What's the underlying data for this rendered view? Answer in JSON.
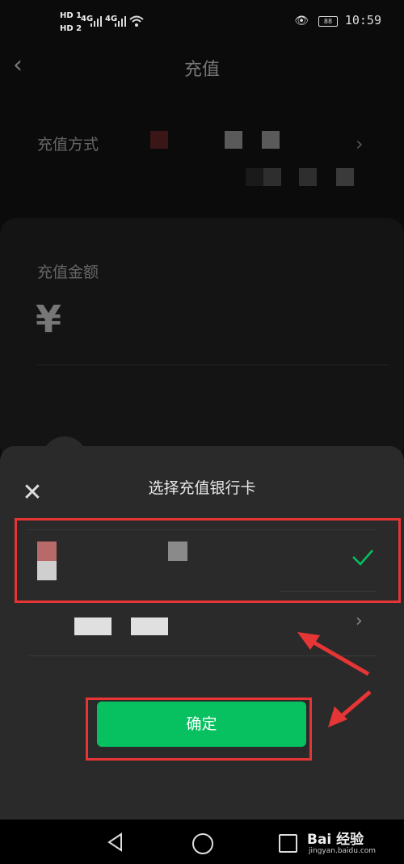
{
  "status_bar": {
    "hd1": "HD 1",
    "hd2": "HD 2",
    "net1": "4G",
    "net2": "4G",
    "battery": "88",
    "time": "10:59"
  },
  "header": {
    "title": "充值"
  },
  "background_page": {
    "recharge_method_label": "充值方式",
    "recharge_amount_label": "充值金额",
    "currency_symbol": "¥"
  },
  "sheet": {
    "title": "选择充值银行卡",
    "confirm_label": "确定"
  },
  "watermark": {
    "brand": "Bai 经验",
    "url": "jingyan.baidu.com"
  },
  "colors": {
    "accent_green": "#07c160",
    "highlight_red": "#e53535"
  }
}
